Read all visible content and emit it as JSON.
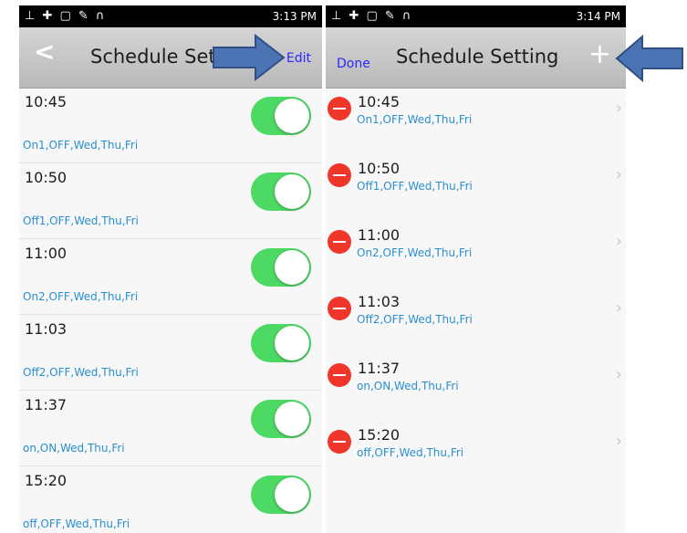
{
  "left": {
    "status_left": "⊥ ✚ ▢ ✎ ∩",
    "status_right": "3:13 PM",
    "title": "Schedule Setting",
    "back": "<",
    "edit": "Edit",
    "items": [
      {
        "time": "10:45",
        "sub": "On1,OFF,Wed,Thu,Fri",
        "on": true
      },
      {
        "time": "10:50",
        "sub": "Off1,OFF,Wed,Thu,Fri",
        "on": true
      },
      {
        "time": "11:00",
        "sub": "On2,OFF,Wed,Thu,Fri",
        "on": true
      },
      {
        "time": "11:03",
        "sub": "Off2,OFF,Wed,Thu,Fri",
        "on": true
      },
      {
        "time": "11:37",
        "sub": "on,ON,Wed,Thu,Fri",
        "on": true
      },
      {
        "time": "15:20",
        "sub": "off,OFF,Wed,Thu,Fri",
        "on": true
      }
    ]
  },
  "right": {
    "status_left": "⊥ ✚ ▢ ✎ ∩",
    "status_right": "3:14 PM",
    "title": "Schedule Setting",
    "done": "Done",
    "plus": "+",
    "items": [
      {
        "time": "10:45",
        "sub": "On1,OFF,Wed,Thu,Fri"
      },
      {
        "time": "10:50",
        "sub": "Off1,OFF,Wed,Thu,Fri"
      },
      {
        "time": "11:00",
        "sub": "On2,OFF,Wed,Thu,Fri"
      },
      {
        "time": "11:03",
        "sub": "Off2,OFF,Wed,Thu,Fri"
      },
      {
        "time": "11:37",
        "sub": "on,ON,Wed,Thu,Fri"
      },
      {
        "time": "15:20",
        "sub": "off,OFF,Wed,Thu,Fri"
      }
    ]
  },
  "colors": {
    "accent": "#2a2aff",
    "toggle_on": "#4cd964",
    "delete": "#f0352a",
    "subtitle": "#2a8fd0",
    "arrow": "#4a74b4"
  }
}
